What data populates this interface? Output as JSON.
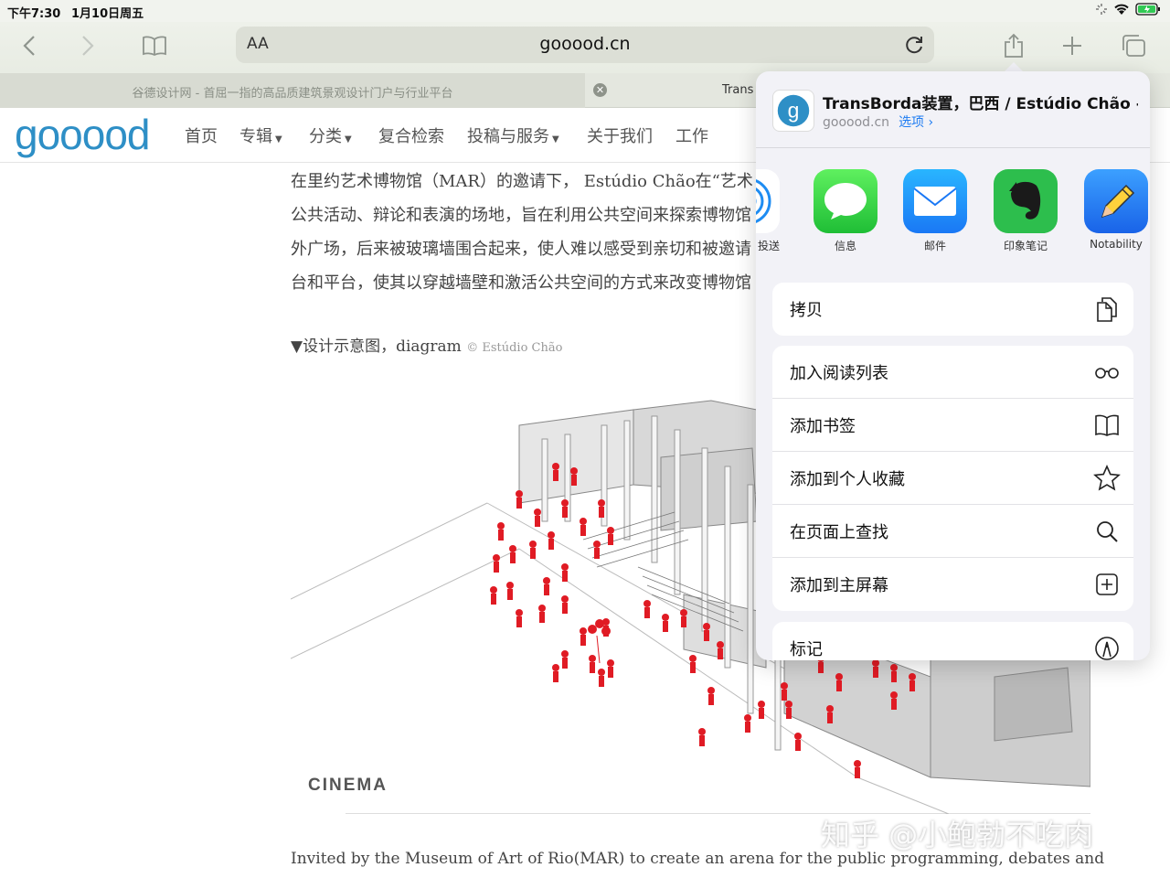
{
  "status": {
    "time": "下午7:30",
    "date": "1月10日周五"
  },
  "toolbar": {
    "reader_label": "AA",
    "url": "gooood.cn"
  },
  "tabs": {
    "tab1_title": "谷德设计网 - 首屈一指的高品质建筑景观设计门户与行业平台",
    "tab2_title": "Trans"
  },
  "site": {
    "logo": "gooood",
    "nav": [
      "首页",
      "专辑",
      "分类",
      "复合检索",
      "投稿与服务",
      "关于我们",
      "工作"
    ]
  },
  "article": {
    "para_lines": [
      "在里约艺术博物馆（MAR）的邀请下， Estúdio Chão在“艺术",
      "公共活动、辩论和表演的场地，旨在利用公共空间来探索博物馆",
      "外广场，后来被玻璃墙围合起来，使人难以感受到亲切和被邀请",
      "台和平台，使其以穿越墙壁和激活公共空间的方式来改变博物馆"
    ],
    "caption": "▼设计示意图，diagram",
    "caption_credit": "© Estúdio Chão",
    "diagram_label": "CINEMA",
    "english_line": "Invited by the Museum of Art of Rio(MAR) to create an arena for the public programming, debates and"
  },
  "watermark": "知乎 @小鲍勃不吃肉",
  "share": {
    "title": "TransBorda装置，巴西 / Estúdio Chão -...",
    "domain": "gooood.cn",
    "options_label": "选项 ›",
    "apps": [
      "投送",
      "信息",
      "邮件",
      "印象笔记",
      "Notability"
    ],
    "actions": [
      {
        "label": "拷贝",
        "icon": "copy-icon"
      },
      {
        "label": "加入阅读列表",
        "icon": "glasses-icon"
      },
      {
        "label": "添加书签",
        "icon": "book-icon"
      },
      {
        "label": "添加到个人收藏",
        "icon": "star-icon"
      },
      {
        "label": "在页面上查找",
        "icon": "search-icon"
      },
      {
        "label": "添加到主屏幕",
        "icon": "add-square-icon"
      },
      {
        "label": "标记",
        "icon": "markup-icon"
      }
    ]
  },
  "colors": {
    "accent": "#1e7cf2",
    "logo": "#2e8fc6",
    "figure_red": "#e01b24"
  }
}
